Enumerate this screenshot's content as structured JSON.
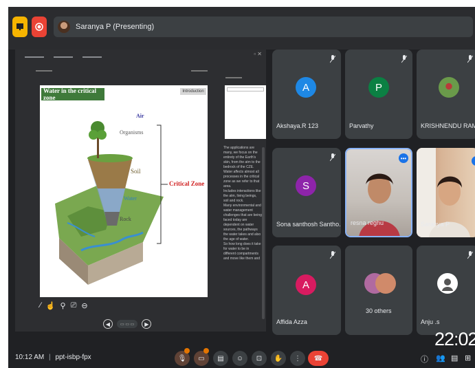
{
  "window": {
    "presenter_label": "Saranya P (Presenting)"
  },
  "slide": {
    "title": "Water in the critical zone",
    "section_tag": "Introduction",
    "labels": {
      "air": "Air",
      "organisms": "Organisms",
      "soil": "Soil",
      "water": "Water",
      "rock": "Rock",
      "critical_zone": "Critical Zone"
    }
  },
  "speaker_notes": [
    "The applications are many, we focus on the entirety of the Earth's skin, from the atm to the bedrock of the CZE.",
    "Water affects almost all processes in the critical zone as we refer to that area.",
    "Includes interactions like the atm, living beings, soil and rock.",
    "Many environmental and water management challenges that are being faced today are dependent on water sources, the pathways the water takes and also the age of water.",
    "So how long does it take for water to be in different compartments and move like them and"
  ],
  "participants": [
    {
      "name": "Akshaya.R 123",
      "initial": "A",
      "color": "#1e88e5",
      "type": "avatar"
    },
    {
      "name": "Parvathy",
      "initial": "P",
      "color": "#0b8043",
      "type": "avatar"
    },
    {
      "name": "KRISHNENDU RAMOAS",
      "initial": "",
      "color": "#6a9a4a",
      "type": "photo"
    },
    {
      "name": "Sona santhosh Santho...",
      "initial": "S",
      "color": "#8e24aa",
      "type": "avatar"
    },
    {
      "name": "resna reghu",
      "initial": "",
      "color": "",
      "type": "video"
    },
    {
      "name": "Saranya P",
      "initial": "",
      "color": "",
      "type": "video"
    },
    {
      "name": "Affida Azza",
      "initial": "A",
      "color": "#d81b60",
      "type": "avatar"
    },
    {
      "name": "30 others",
      "initial": "",
      "color": "",
      "type": "group"
    },
    {
      "name": "Anju .s",
      "initial": "",
      "color": "#ffffff",
      "type": "photo"
    }
  ],
  "overlay_time": "22:02",
  "bottom": {
    "clock": "10:12 AM",
    "meeting_code": "ppt-isbp-fpx"
  },
  "colors": {
    "accent_blue": "#1a73e8",
    "end_call_red": "#ea4335",
    "hand_orange": "#e37400"
  }
}
